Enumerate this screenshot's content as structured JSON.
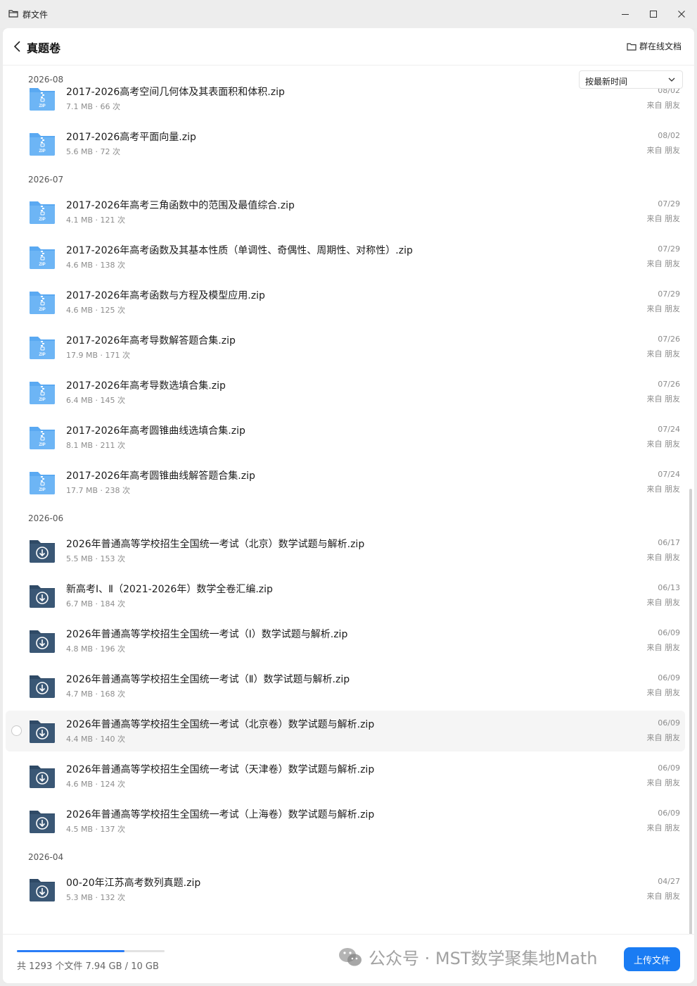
{
  "window": {
    "title": "群文件",
    "icons": {
      "app": "folder-icon",
      "minimize": "minimize-icon",
      "maximize": "maximize-icon",
      "close": "close-icon"
    }
  },
  "header": {
    "title": "真题卷",
    "back_icon": "chevron-left-icon",
    "online_docs_label": "群在线文档"
  },
  "sort": {
    "selected": "按最新时间"
  },
  "colors": {
    "accent": "#1a7cf3",
    "zip_folder": "#5aa9f2",
    "download_icon_bg": "#2f4a66"
  },
  "groups": [
    {
      "label": "2026-08",
      "files": [
        {
          "icon": "zip-folder-icon",
          "name": "2017-2026高考空间几何体及其表面积和体积.zip",
          "meta": "7.1 MB · 66 次",
          "date": "08/02",
          "source": "来自 朋友"
        },
        {
          "icon": "zip-folder-icon",
          "name": "2017-2026高考平面向量.zip",
          "meta": "5.6 MB · 72 次",
          "date": "08/02",
          "source": "来自 朋友"
        }
      ]
    },
    {
      "label": "2026-07",
      "files": [
        {
          "icon": "zip-folder-icon",
          "name": "2017-2026年高考三角函数中的范围及最值综合.zip",
          "meta": "4.1 MB · 121 次",
          "date": "07/29",
          "source": "来自 朋友"
        },
        {
          "icon": "zip-folder-icon",
          "name": "2017-2026年高考函数及其基本性质（单调性、奇偶性、周期性、对称性）.zip",
          "meta": "4.6 MB · 138 次",
          "date": "07/29",
          "source": "来自 朋友"
        },
        {
          "icon": "zip-folder-icon",
          "name": "2017-2026年高考函数与方程及模型应用.zip",
          "meta": "4.6 MB · 125 次",
          "date": "07/29",
          "source": "来自 朋友"
        },
        {
          "icon": "zip-folder-icon",
          "name": "2017-2026年高考导数解答题合集.zip",
          "meta": "17.9 MB · 171 次",
          "date": "07/26",
          "source": "来自 朋友"
        },
        {
          "icon": "zip-folder-icon",
          "name": "2017-2026年高考导数选填合集.zip",
          "meta": "6.4 MB · 145 次",
          "date": "07/26",
          "source": "来自 朋友"
        },
        {
          "icon": "zip-folder-icon",
          "name": "2017-2026年高考圆锥曲线选填合集.zip",
          "meta": "8.1 MB · 211 次",
          "date": "07/24",
          "source": "来自 朋友"
        },
        {
          "icon": "zip-folder-icon",
          "name": "2017-2026年高考圆锥曲线解答题合集.zip",
          "meta": "17.7 MB · 238 次",
          "date": "07/24",
          "source": "来自 朋友"
        }
      ]
    },
    {
      "label": "2026-06",
      "files": [
        {
          "icon": "download-file-icon",
          "name": "2026年普通高等学校招生全国统一考试（北京）数学试题与解析.zip",
          "meta": "5.5 MB · 153 次",
          "date": "06/17",
          "source": "来自 朋友"
        },
        {
          "icon": "download-file-icon",
          "name": "新高考Ⅰ、Ⅱ（2021-2026年）数学全卷汇编.zip",
          "meta": "6.7 MB · 184 次",
          "date": "06/13",
          "source": "来自 朋友"
        },
        {
          "icon": "download-file-icon",
          "name": "2026年普通高等学校招生全国统一考试（Ⅰ）数学试题与解析.zip",
          "meta": "4.8 MB · 196 次",
          "date": "06/09",
          "source": "来自 朋友"
        },
        {
          "icon": "download-file-icon",
          "name": "2026年普通高等学校招生全国统一考试（Ⅱ）数学试题与解析.zip",
          "meta": "4.7 MB · 168 次",
          "date": "06/09",
          "source": "来自 朋友"
        },
        {
          "icon": "download-file-icon",
          "name": "2026年普通高等学校招生全国统一考试（北京卷）数学试题与解析.zip",
          "meta": "4.4 MB · 140 次",
          "date": "06/09",
          "source": "来自 朋友"
        },
        {
          "icon": "download-file-icon",
          "name": "2026年普通高等学校招生全国统一考试（天津卷）数学试题与解析.zip",
          "meta": "4.6 MB · 124 次",
          "date": "06/09",
          "source": "来自 朋友"
        },
        {
          "icon": "download-file-icon",
          "name": "2026年普通高等学校招生全国统一考试（上海卷）数学试题与解析.zip",
          "meta": "4.5 MB · 137 次",
          "date": "06/09",
          "source": "来自 朋友"
        }
      ]
    },
    {
      "label": "2026-04",
      "files": [
        {
          "icon": "download-file-icon",
          "name": "00-20年江苏高考数列真题.zip",
          "meta": "5.3 MB · 132 次",
          "date": "04/27",
          "source": "来自 朋友"
        }
      ]
    }
  ],
  "footer": {
    "storage_text": "共 1293 个文件 7.94 GB / 10 GB",
    "storage_fraction": 0.794,
    "watermark": "公众号 · MST数学聚集地Math",
    "upload_label": "上传文件"
  }
}
